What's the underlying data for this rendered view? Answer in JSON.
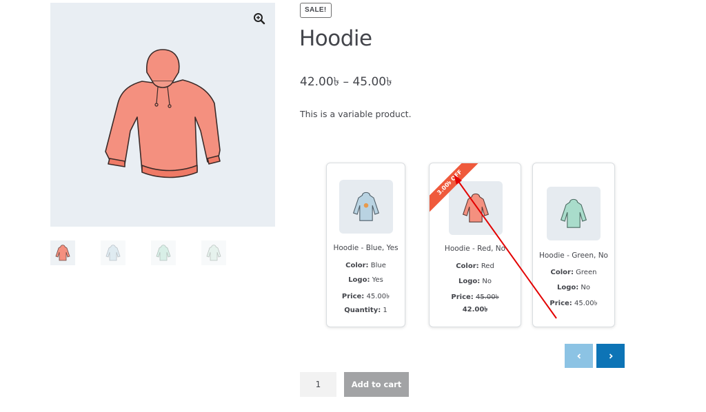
{
  "sale_badge": "SALE!",
  "product": {
    "title": "Hoodie",
    "price_range": "42.00৳ – 45.00৳",
    "description": "This is a variable product."
  },
  "variations": [
    {
      "name": "Hoodie - Blue, Yes",
      "color_label": "Color:",
      "color": "Blue",
      "logo_label": "Logo:",
      "logo": "Yes",
      "price_label": "Price:",
      "price": "45.00৳",
      "quantity_label": "Quantity:",
      "quantity": "1",
      "icon": "blue-hoodie-icon"
    },
    {
      "name": "Hoodie - Red, No",
      "ribbon": "3.00৳ OFF",
      "color_label": "Color:",
      "color": "Red",
      "logo_label": "Logo:",
      "logo": "No",
      "price_label": "Price:",
      "old_price": "45.00৳",
      "sale_price": "42.00৳",
      "icon": "red-hoodie-icon"
    },
    {
      "name": "Hoodie - Green, No",
      "color_label": "Color:",
      "color": "Green",
      "logo_label": "Logo:",
      "logo": "No",
      "price_label": "Price:",
      "price": "45.00৳",
      "icon": "green-hoodie-icon"
    }
  ],
  "cart": {
    "quantity": "1",
    "button": "Add to cart"
  },
  "colors": {
    "ribbon": "#ef5a3c",
    "annotation_arrow": "#e30000",
    "nav_prev": "#8cc3e4",
    "nav_next": "#0d74b6",
    "button": "#a2a3a5",
    "image_bg": "#e9eef3"
  },
  "icons": [
    "zoom-icon",
    "chevron-left-icon",
    "chevron-right-icon"
  ]
}
